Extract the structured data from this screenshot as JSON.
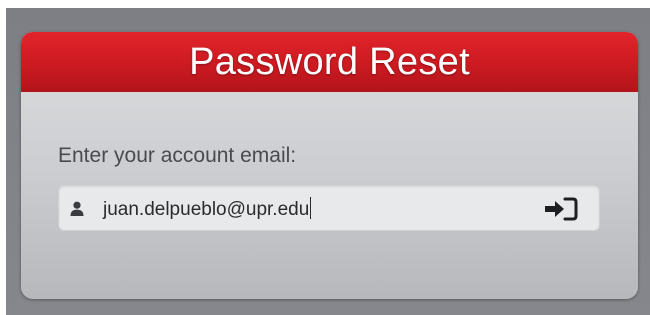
{
  "dialog": {
    "title": "Password Reset",
    "prompt": "Enter your account email:",
    "email_input": {
      "value": "juan.delpueblo@upr.edu",
      "icon": "user-icon"
    },
    "submit_icon": "sign-in-icon"
  },
  "colors": {
    "header_red": "#cc1a21",
    "backdrop_gray": "#7d7f85",
    "card_gray": "#cfd0d3"
  }
}
